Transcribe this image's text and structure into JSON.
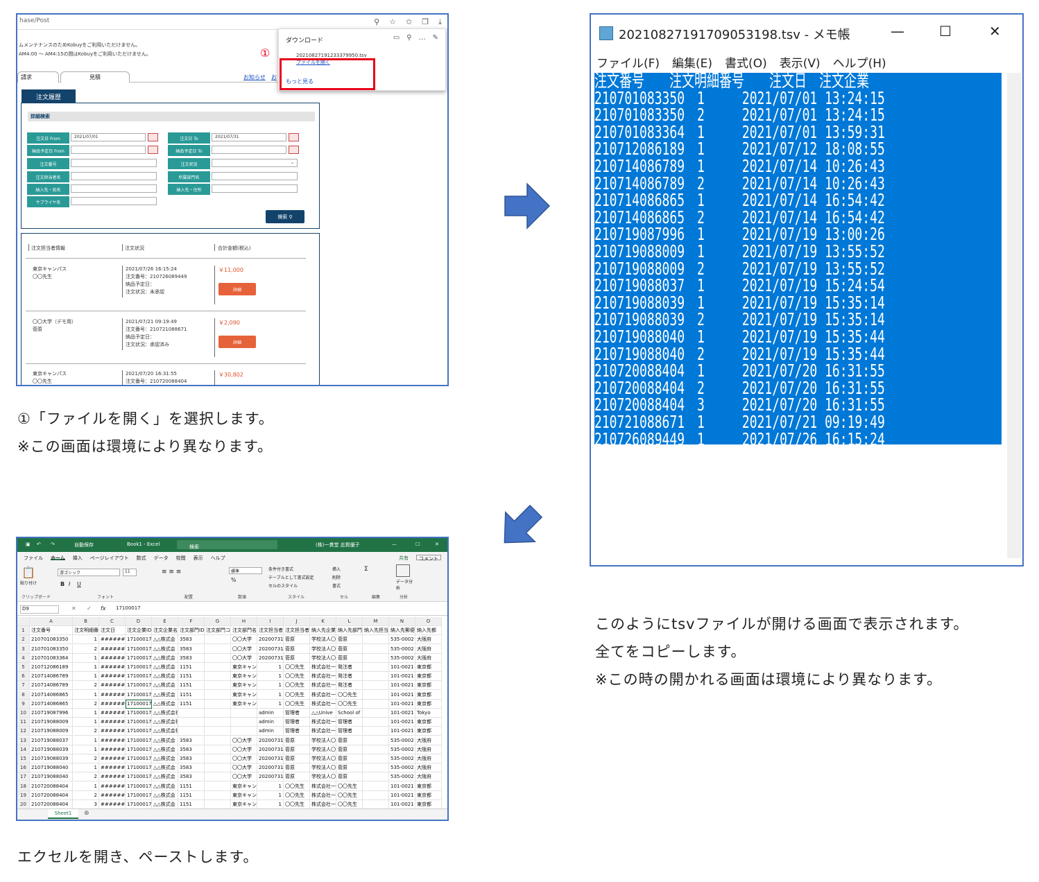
{
  "browser": {
    "address": "hase/Post",
    "notice_lines": [
      "ムメンテナンスのためKobuyをご利用いただけません。",
      "AM4:00 ～ AM4:15の間はKobuyをご利用いただけません。"
    ],
    "tabs": [
      "請求",
      "見積"
    ],
    "links": [
      "お知らせ",
      "お"
    ],
    "history_tab": "注文履歴",
    "search_header": "詳細検索",
    "fields": {
      "order_date_from": "注文日 From",
      "order_date_from_value": "2021/07/01",
      "order_date_to": "注文日 To",
      "order_date_to_value": "2021/07/31",
      "delivery_from": "納品予定日 From",
      "delivery_to": "納品予定日 To",
      "order_no": "注文番号",
      "order_status": "注文状況",
      "orderer": "注文担当者名",
      "dept": "所属部門名",
      "dest_name": "納入先・宛名",
      "dest_addr": "納入先・住所",
      "supplier": "サプライヤ名"
    },
    "search_button": "検索",
    "list_headers": [
      "注文担当者情報",
      "注文状況",
      "合計金額(税込)"
    ],
    "orders": [
      {
        "who": "東京キャンパス\n〇〇先生",
        "status": "2021/07/26 16:15:24\n注文番号：210726089449\n納品予定日：\n注文状況：未承認",
        "price": "￥11,000",
        "button": "詳細"
      },
      {
        "who": "〇〇大学（デモ用）\n菅原",
        "status": "2021/07/21 09:19:49\n注文番号：210721088671\n納品予定日：\n注文状況：承認済み",
        "price": "￥2,090",
        "button": "詳細"
      },
      {
        "who": "東京キャンパス\n〇〇先生",
        "status": "2021/07/20 16:31:55\n注文番号：210720088404",
        "price": "￥30,802"
      }
    ],
    "download_panel": {
      "title": "ダウンロード",
      "file": "20210827191233379950.tsv",
      "open_link": "ファイルを開く",
      "more": "もっと見る"
    },
    "marker": "①"
  },
  "captions": {
    "step1_line1": "①「ファイルを開く」を選択します。",
    "step1_line2": "※この画面は環境により異なります。",
    "step2_line1": "このようにtsvファイルが開ける画面で表示されます。",
    "step2_line2": "全てをコピーします。",
    "step2_line3": "※この時の開かれる画面は環境により異なります。",
    "step3_line1": "エクセルを開き、ペーストします。"
  },
  "notepad": {
    "title": "20210827191709053198.tsv - メモ帳",
    "menu": [
      "ファイル(F)",
      "編集(E)",
      "書式(O)",
      "表示(V)",
      "ヘルプ(H)"
    ],
    "rows": [
      "注文番号　　注文明細番号　　注文日　注文企業",
      "210701083350　1　　　2021/07/01 13:24:15",
      "210701083350　2　　　2021/07/01 13:24:15",
      "210701083364　1　　　2021/07/01 13:59:31",
      "210712086189　1　　　2021/07/12 18:08:55",
      "210714086789　1　　　2021/07/14 10:26:43",
      "210714086789　2　　　2021/07/14 10:26:43",
      "210714086865　1　　　2021/07/14 16:54:42",
      "210714086865　2　　　2021/07/14 16:54:42",
      "210719087996　1　　　2021/07/19 13:00:26",
      "210719088009　1　　　2021/07/19 13:55:52",
      "210719088009　2　　　2021/07/19 13:55:52",
      "210719088037　1　　　2021/07/19 15:24:54",
      "210719088039　1　　　2021/07/19 15:35:14",
      "210719088039　2　　　2021/07/19 15:35:14",
      "210719088040　1　　　2021/07/19 15:35:44",
      "210719088040　2　　　2021/07/19 15:35:44",
      "210720088404　1　　　2021/07/20 16:31:55",
      "210720088404　2　　　2021/07/20 16:31:55",
      "210720088404　3　　　2021/07/20 16:31:55",
      "210721088671　1　　　2021/07/21 09:19:49",
      "210726089449　1　　　2021/07/26 16:15:24"
    ]
  },
  "excel": {
    "autosave": "自動保存",
    "book": "Book1 - Excel",
    "search": "検索",
    "user": "(株)一貫堂 志賀優子",
    "tabs": [
      "ファイル",
      "ホーム",
      "挿入",
      "ページレイアウト",
      "数式",
      "データ",
      "校閲",
      "表示",
      "ヘルプ"
    ],
    "share": "共有",
    "comment": "コメント",
    "font_name": "游ゴシック",
    "font_size": "11",
    "number_format": "標準",
    "groups": [
      "クリップボード",
      "フォント",
      "配置",
      "数値",
      "スタイル",
      "セル",
      "編集",
      "分析"
    ],
    "ribbon_labels": [
      "貼り付け",
      "条件付き書式",
      "テーブルとして書式設定",
      "セルのスタイル",
      "挿入",
      "削除",
      "書式",
      "データ分析"
    ],
    "name_box": "D9",
    "formula": "17100017",
    "sheet": "Sheet1",
    "columns": [
      "A",
      "B",
      "C",
      "D",
      "E",
      "F",
      "G",
      "H",
      "I",
      "J",
      "K",
      "L",
      "M",
      "N",
      "O"
    ],
    "header_row": [
      "注文番号",
      "注文明細番",
      "注文日",
      "注文企業ID",
      "注文企業名",
      "注文部門ID",
      "注文部門コ",
      "注文部門名",
      "注文担当者",
      "注文担当者",
      "納入先企業",
      "納入先部門",
      "納入先担当",
      "納入先郵便",
      "納入先都"
    ],
    "rows": [
      [
        "210701083350",
        "1",
        "########",
        "17100017",
        "△△株式会",
        "3583",
        "",
        "〇〇大学",
        "20200731",
        "菅原",
        "学校法人〇〇大学",
        "菅原",
        "",
        "535-0002",
        "大阪府"
      ],
      [
        "210701083350",
        "2",
        "########",
        "17100017",
        "△△株式会",
        "3583",
        "",
        "〇〇大学",
        "20200731",
        "菅原",
        "学校法人〇〇大学",
        "菅原",
        "",
        "535-0002",
        "大阪府"
      ],
      [
        "210701083364",
        "1",
        "########",
        "17100017",
        "△△株式会",
        "3583",
        "",
        "〇〇大学",
        "20200731",
        "菅原",
        "学校法人〇〇大学",
        "菅原",
        "",
        "535-0002",
        "大阪府"
      ],
      [
        "210712086189",
        "1",
        "########",
        "17100017",
        "△△株式会",
        "1151",
        "",
        "東京キャン",
        "1",
        "〇〇先生",
        "株式会社一貫堂",
        "発注者",
        "",
        "101-0021",
        "東京都"
      ],
      [
        "210714086789",
        "1",
        "########",
        "17100017",
        "△△株式会",
        "1151",
        "",
        "東京キャン",
        "1",
        "〇〇先生",
        "株式会社一貫堂",
        "発注者",
        "",
        "101-0021",
        "東京都"
      ],
      [
        "210714086789",
        "2",
        "########",
        "17100017",
        "△△株式会",
        "1151",
        "",
        "東京キャン",
        "1",
        "〇〇先生",
        "株式会社一貫堂",
        "発注者",
        "",
        "101-0021",
        "東京都"
      ],
      [
        "210714086865",
        "1",
        "########",
        "17100017",
        "△△株式会",
        "1151",
        "",
        "東京キャン",
        "1",
        "〇〇先生",
        "株式会社一貫堂",
        "〇〇先生",
        "",
        "101-0021",
        "東京都"
      ],
      [
        "210714086865",
        "2",
        "########",
        "17100017",
        "△△株式会",
        "1151",
        "",
        "東京キャン",
        "1",
        "〇〇先生",
        "株式会社一貫堂",
        "〇〇先生",
        "",
        "101-0021",
        "東京都"
      ],
      [
        "210719087996",
        "1",
        "########",
        "17100017",
        "△△株式会社",
        "",
        "",
        "",
        "admin",
        "管理者",
        "△△Unive",
        "School of Shiga",
        "",
        "101-0021",
        "Tokyo"
      ],
      [
        "210719088009",
        "1",
        "########",
        "17100017",
        "△△株式会社",
        "",
        "",
        "",
        "admin",
        "管理者",
        "株式会社一貫堂",
        "管理者",
        "",
        "101-0021",
        "東京都"
      ],
      [
        "210719088009",
        "2",
        "########",
        "17100017",
        "△△株式会社",
        "",
        "",
        "",
        "admin",
        "管理者",
        "株式会社一貫堂",
        "管理者",
        "",
        "101-0021",
        "東京都"
      ],
      [
        "210719088037",
        "1",
        "########",
        "17100017",
        "△△株式会",
        "3583",
        "",
        "〇〇大学",
        "20200731",
        "菅原",
        "学校法人〇〇大学",
        "菅原",
        "",
        "535-0002",
        "大阪府"
      ],
      [
        "210719088039",
        "1",
        "########",
        "17100017",
        "△△株式会",
        "3583",
        "",
        "〇〇大学",
        "20200731",
        "菅原",
        "学校法人〇〇大学",
        "菅原",
        "",
        "535-0002",
        "大阪府"
      ],
      [
        "210719088039",
        "2",
        "########",
        "17100017",
        "△△株式会",
        "3583",
        "",
        "〇〇大学",
        "20200731",
        "菅原",
        "学校法人〇〇大学",
        "菅原",
        "",
        "535-0002",
        "大阪府"
      ],
      [
        "210719088040",
        "1",
        "########",
        "17100017",
        "△△株式会",
        "3583",
        "",
        "〇〇大学",
        "20200731",
        "菅原",
        "学校法人〇〇大学",
        "菅原",
        "",
        "535-0002",
        "大阪府"
      ],
      [
        "210719088040",
        "2",
        "########",
        "17100017",
        "△△株式会",
        "3583",
        "",
        "〇〇大学",
        "20200731",
        "菅原",
        "学校法人〇〇大学",
        "菅原",
        "",
        "535-0002",
        "大阪府"
      ],
      [
        "210720088404",
        "1",
        "########",
        "17100017",
        "△△株式会",
        "1151",
        "",
        "東京キャン",
        "1",
        "〇〇先生",
        "株式会社一貫堂",
        "〇〇先生",
        "",
        "101-0021",
        "東京都"
      ],
      [
        "210720088404",
        "2",
        "########",
        "17100017",
        "△△株式会",
        "1151",
        "",
        "東京キャン",
        "1",
        "〇〇先生",
        "株式会社一貫堂",
        "〇〇先生",
        "",
        "101-0021",
        "東京都"
      ],
      [
        "210720088404",
        "3",
        "########",
        "17100017",
        "△△株式会",
        "1151",
        "",
        "東京キャン",
        "1",
        "〇〇先生",
        "株式会社一貫堂",
        "〇〇先生",
        "",
        "101-0021",
        "東京都"
      ]
    ]
  },
  "colors": {
    "accent_blue": "#4472c4",
    "red_box": "#e8001a",
    "selection": "#0078d7",
    "excel_green": "#217346"
  }
}
